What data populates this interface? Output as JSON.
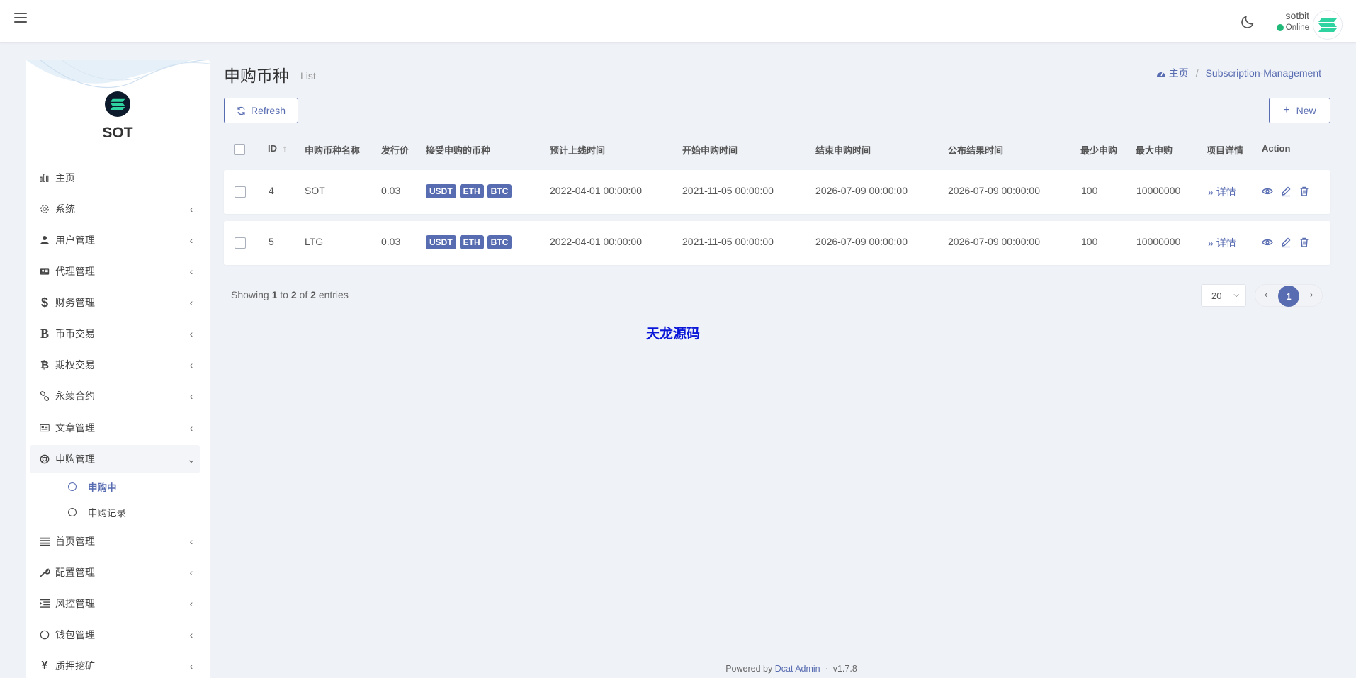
{
  "header": {
    "user_name": "sotbit",
    "user_status": "Online"
  },
  "sidebar": {
    "brand": "SOT",
    "items": [
      {
        "label": "主页",
        "icon": "bar-chart-icon"
      },
      {
        "label": "系统",
        "icon": "gear-icon"
      },
      {
        "label": "用户管理",
        "icon": "user-icon"
      },
      {
        "label": "代理管理",
        "icon": "id-card-icon"
      },
      {
        "label": "财务管理",
        "icon": "dollar-icon"
      },
      {
        "label": "币币交易",
        "icon": "bold-b-icon"
      },
      {
        "label": "期权交易",
        "icon": "bitcoin-icon"
      },
      {
        "label": "永续合约",
        "icon": "link-icon"
      },
      {
        "label": "文章管理",
        "icon": "newspaper-icon"
      },
      {
        "label": "申购管理",
        "icon": "life-ring-icon"
      },
      {
        "label": "首页管理",
        "icon": "list-icon"
      },
      {
        "label": "配置管理",
        "icon": "wrench-icon"
      },
      {
        "label": "风控管理",
        "icon": "indent-icon"
      },
      {
        "label": "钱包管理",
        "icon": "circle-icon"
      },
      {
        "label": "质押挖矿",
        "icon": "yen-icon"
      }
    ],
    "sub_items": [
      {
        "label": "申购中"
      },
      {
        "label": "申购记录"
      }
    ]
  },
  "page": {
    "title": "申购币种",
    "subtitle": "List",
    "breadcrumb_home": "主页",
    "breadcrumb_current": "Subscription-Management",
    "refresh_label": "Refresh",
    "new_label": "New"
  },
  "table": {
    "headers": [
      "ID",
      "申购币种名称",
      "发行价",
      "接受申购的币种",
      "预计上线时间",
      "开始申购时间",
      "结束申购时间",
      "公布结果时间",
      "最少申购",
      "最大申购",
      "项目详情",
      "Action"
    ],
    "rows": [
      {
        "id": "4",
        "name": "SOT",
        "price": "0.03",
        "currencies": [
          "USDT",
          "ETH",
          "BTC"
        ],
        "online_time": "2022-04-01 00:00:00",
        "start_time": "2021-11-05 00:00:00",
        "end_time": "2026-07-09 00:00:00",
        "publish_time": "2026-07-09 00:00:00",
        "min": "100",
        "max": "10000000",
        "detail": "详情"
      },
      {
        "id": "5",
        "name": "LTG",
        "price": "0.03",
        "currencies": [
          "USDT",
          "ETH",
          "BTC"
        ],
        "online_time": "2022-04-01 00:00:00",
        "start_time": "2021-11-05 00:00:00",
        "end_time": "2026-07-09 00:00:00",
        "publish_time": "2026-07-09 00:00:00",
        "min": "100",
        "max": "10000000",
        "detail": "详情"
      }
    ]
  },
  "pagination": {
    "showing_prefix": "Showing",
    "from": "1",
    "to_word": "to",
    "to": "2",
    "of_word": "of",
    "total": "2",
    "entries_word": "entries",
    "per_page": "20",
    "current_page": "1"
  },
  "watermark": "天龙源码",
  "footer": {
    "powered_by": "Powered by",
    "link": "Dcat Admin",
    "separator": "·",
    "version": "v1.7.8"
  },
  "colors": {
    "accent": "#586cb1",
    "background": "#eff2f7",
    "online": "#21b978",
    "watermark": "#0a16d8"
  }
}
